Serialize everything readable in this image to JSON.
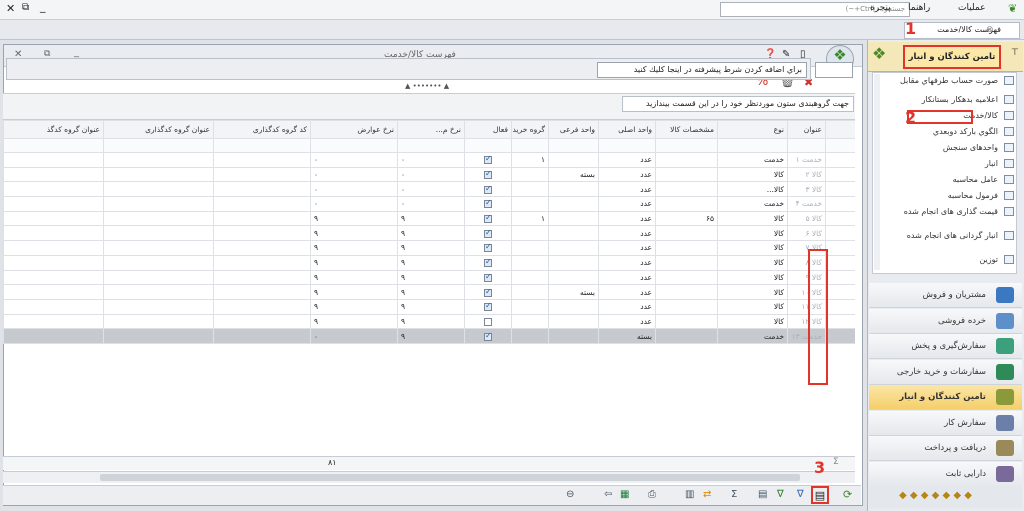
{
  "top": {
    "menus": [
      "عملیات",
      "راهنما",
      "پنجره"
    ],
    "search_placeholder": "جستجو... (Ctrl+~)"
  },
  "tab": {
    "label": "فهرست کالا/خدمت"
  },
  "window": {
    "title": "فهرست کالا/خدمت",
    "filter_button": "براي اضافه كردن شرط پيشرفته در اينجا كليك كنيد",
    "group_hint": "جهت گروهبندی ستون موردنظر خود را در این قسمت بیندازید"
  },
  "grid": {
    "headers": [
      "کد",
      "عنوان",
      "نوع",
      "مشخصات کالا",
      "واحد اصلی",
      "واحد فرعی",
      "گروه خرید",
      "فعال",
      "نرخ م...",
      "نرخ عوارض",
      "کد گروه کدگذاری",
      "عنوان گروه کدگذاری",
      "عنوان گروه کدگذ"
    ],
    "rows": [
      {
        "num": "۱",
        "title": "خدمت ۱",
        "type": "خدمت",
        "spec": "",
        "unit": "عدد",
        "sub": "",
        "grp": "۱",
        "active": true,
        "rate": "۰",
        "tax": "۰"
      },
      {
        "num": "۲",
        "title": "کالا ۲",
        "type": "کالا",
        "spec": "",
        "unit": "عدد",
        "sub": "بسته",
        "grp": "",
        "active": true,
        "rate": "۰",
        "tax": "۰"
      },
      {
        "num": "۳",
        "title": "کالا ۳",
        "type": "کالا...",
        "spec": "",
        "unit": "عدد",
        "sub": "",
        "grp": "",
        "active": true,
        "rate": "۰",
        "tax": "۰"
      },
      {
        "num": "۴",
        "title": "خدمت ۴",
        "type": "خدمت",
        "spec": "",
        "unit": "عدد",
        "sub": "",
        "grp": "",
        "active": true,
        "rate": "۰",
        "tax": "۰"
      },
      {
        "num": "۵",
        "title": "کالا ۵",
        "type": "کالا",
        "spec": "۶۵",
        "unit": "عدد",
        "sub": "",
        "grp": "۱",
        "active": true,
        "rate": "۹",
        "tax": "۹"
      },
      {
        "num": "۶",
        "title": "کالا ۶",
        "type": "کالا",
        "spec": "",
        "unit": "عدد",
        "sub": "",
        "grp": "",
        "active": true,
        "rate": "۹",
        "tax": "۹"
      },
      {
        "num": "۷",
        "title": "کالا ۷",
        "type": "کالا",
        "spec": "",
        "unit": "عدد",
        "sub": "",
        "grp": "",
        "active": true,
        "rate": "۹",
        "tax": "۹"
      },
      {
        "num": "۸",
        "title": "کالا ۸",
        "type": "کالا",
        "spec": "",
        "unit": "عدد",
        "sub": "",
        "grp": "",
        "active": true,
        "rate": "۹",
        "tax": "۹"
      },
      {
        "num": "۹",
        "title": "کالا ۹",
        "type": "کالا",
        "spec": "",
        "unit": "عدد",
        "sub": "",
        "grp": "",
        "active": true,
        "rate": "۹",
        "tax": "۹"
      },
      {
        "num": "۱۰",
        "title": "کالا ۱۰",
        "type": "کالا",
        "spec": "",
        "unit": "عدد",
        "sub": "بسته",
        "grp": "",
        "active": true,
        "rate": "۹",
        "tax": "۹"
      },
      {
        "num": "۱۱",
        "title": "کالا ۱۱",
        "type": "کالا",
        "spec": "",
        "unit": "عدد",
        "sub": "",
        "grp": "",
        "active": true,
        "rate": "۹",
        "tax": "۹"
      },
      {
        "num": "۱۲",
        "title": "کالا ۱۲",
        "type": "کالا",
        "spec": "",
        "unit": "عدد",
        "sub": "",
        "grp": "",
        "active": false,
        "rate": "۹",
        "tax": "۹"
      },
      {
        "num": "۱۳",
        "title": "خدمت ۱۳",
        "type": "خدمت",
        "spec": "",
        "unit": "بسته",
        "sub": "",
        "grp": "",
        "active": true,
        "rate": "۹",
        "tax": "۰"
      }
    ],
    "sum": "۸۱"
  },
  "sidebar": {
    "title": "تامین کنندگان و انبار",
    "tree": [
      "صورت حساب طرفهاي مقابل",
      "اعلاميه بدهكار بستانكار",
      "كالا/خدمت",
      "الگوي باركد دوبعدي",
      "واحدهای سنجش",
      "انبار",
      "عامل محاسبه",
      "فرمول محاسبه",
      "قیمت گذاری های انجام شده",
      "انبار گردانی های انجام شده",
      "توزین"
    ],
    "nav": [
      "مشتریان و فروش",
      "خرده فروشی",
      "سفارش‌گیری و پخش",
      "سفارشات و خرید خارجی",
      "تامین کنندگان و انبار",
      "سفارش کار",
      "دریافت و پرداخت",
      "دارایی ثابت"
    ]
  },
  "markers": [
    "1",
    "2",
    "3"
  ],
  "colors": {
    "accent": "#f5cf6b",
    "marker": "#e3342c"
  }
}
